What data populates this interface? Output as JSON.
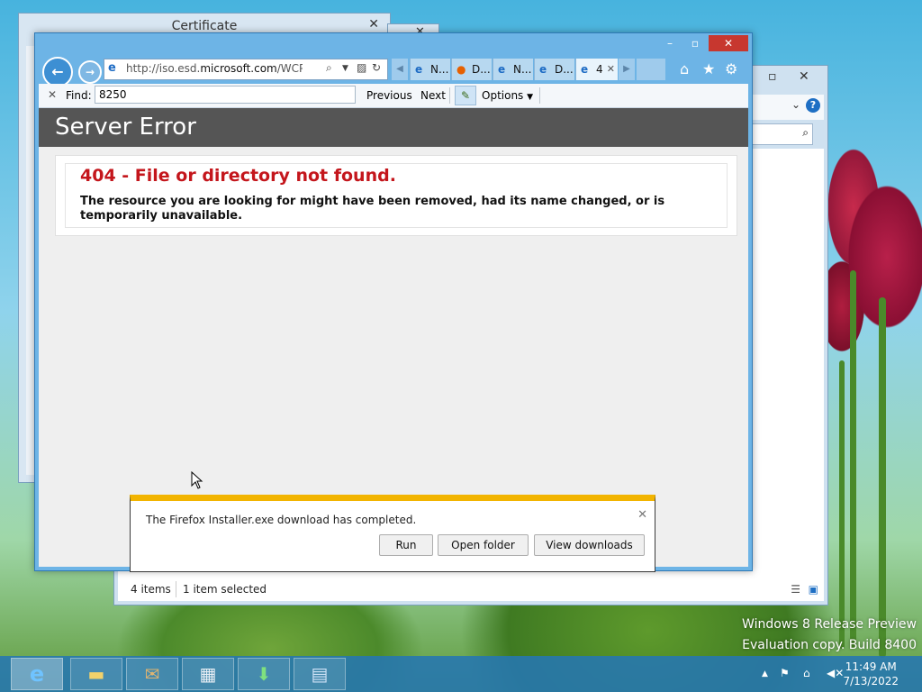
{
  "cert_window": {
    "title": "Certificate",
    "close_icon": "close-icon"
  },
  "explorer_window": {
    "status_items": "4 items",
    "status_selected": "1 item selected"
  },
  "browser": {
    "address": {
      "prefix": "http://iso.esd.",
      "domain": "microsoft.com",
      "path": "/WCPDL/BD'"
    },
    "tabs": [
      {
        "label": "N...",
        "icon": "ie-icon"
      },
      {
        "label": "D...",
        "icon": "firefox-icon"
      },
      {
        "label": "N...",
        "icon": "ie-icon"
      },
      {
        "label": "D...",
        "icon": "ie-icon"
      },
      {
        "label": "4",
        "icon": "ie-icon",
        "active": true
      }
    ],
    "find": {
      "label": "Find:",
      "value": "8250",
      "previous": "Previous",
      "next": "Next",
      "options": "Options"
    }
  },
  "page": {
    "banner": "Server Error",
    "error_title": "404 - File or directory not found.",
    "error_message": "The resource you are looking for might have been removed, had its name changed, or is temporarily unavailable."
  },
  "download": {
    "message": "The Firefox Installer.exe download has completed.",
    "run": "Run",
    "open_folder": "Open folder",
    "view_downloads": "View downloads"
  },
  "watermark": {
    "line1": "Windows 8 Release Preview",
    "line2": "Evaluation copy. Build 8400"
  },
  "clock": {
    "time": "11:49 AM",
    "date": "7/13/2022"
  },
  "colors": {
    "error_red": "#c4161c",
    "banner_gray": "#555555",
    "notification_bar": "#f2b400",
    "close_red": "#c7372f"
  }
}
